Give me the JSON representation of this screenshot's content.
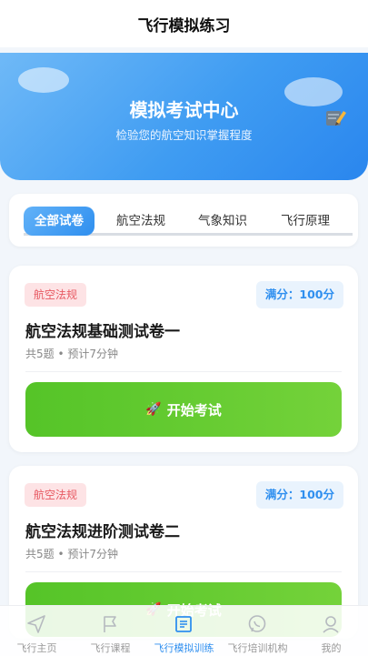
{
  "header": {
    "title": "飞行模拟练习"
  },
  "hero": {
    "title": "模拟考试中心",
    "subtitle": "检验您的航空知识掌握程度",
    "icon": "pencil-icon"
  },
  "tabs": [
    {
      "label": "全部试卷",
      "active": true
    },
    {
      "label": "航空法规",
      "active": false
    },
    {
      "label": "气象知识",
      "active": false
    },
    {
      "label": "飞行原理",
      "active": false
    }
  ],
  "exams": [
    {
      "category": "航空法规",
      "score": "满分：100分",
      "title": "航空法规基础测试卷一",
      "meta": "共5题 • 预计7分钟",
      "button": "开始考试"
    },
    {
      "category": "航空法规",
      "score": "满分：100分",
      "title": "航空法规进阶测试卷二",
      "meta": "共5题 • 预计7分钟",
      "button": "开始考试"
    }
  ],
  "bottom_nav": [
    {
      "label": "飞行主页",
      "icon": "paper-plane-icon",
      "active": false
    },
    {
      "label": "飞行课程",
      "icon": "flag-icon",
      "active": false
    },
    {
      "label": "飞行模拟训练",
      "icon": "book-icon",
      "active": true
    },
    {
      "label": "飞行培训机构",
      "icon": "chat-icon",
      "active": false
    },
    {
      "label": "我的",
      "icon": "user-icon",
      "active": false
    }
  ],
  "colors": {
    "accent": "#2f8fef",
    "start_button": "#5ec72e",
    "badge_bg": "#fde3e5",
    "badge_text": "#e85a63"
  }
}
